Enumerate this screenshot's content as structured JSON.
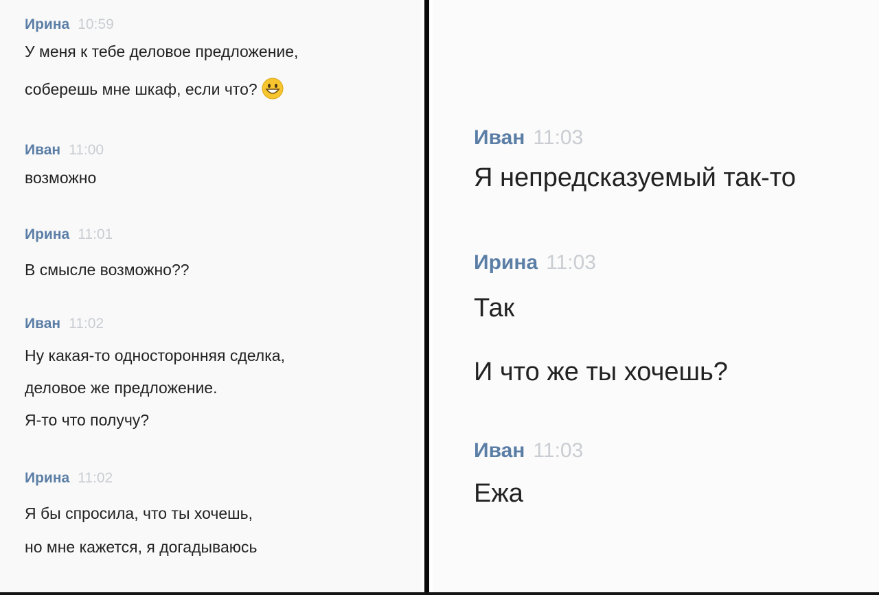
{
  "chat_left": {
    "messages": [
      {
        "author": "Ирина",
        "time": "10:59",
        "lines": [
          "У меня к тебе деловое предложение,",
          "соберешь мне шкаф, если что?"
        ],
        "emoji": "grinning-face-emoji"
      },
      {
        "author": "Иван",
        "time": "11:00",
        "lines": [
          "возможно"
        ]
      },
      {
        "author": "Ирина",
        "time": "11:01",
        "lines": [
          "В смысле возможно??"
        ]
      },
      {
        "author": "Иван",
        "time": "11:02",
        "lines": [
          "Ну какая-то односторонняя сделка,",
          "деловое же предложение.",
          "Я-то что получу?"
        ]
      },
      {
        "author": "Ирина",
        "time": "11:02",
        "lines": [
          "Я бы спросила, что ты хочешь,",
          "но мне кажется, я догадываюсь"
        ]
      }
    ]
  },
  "chat_right": {
    "messages": [
      {
        "author": "Иван",
        "time": "11:03",
        "lines": [
          "Я непредсказуемый так-то"
        ]
      },
      {
        "author": "Ирина",
        "time": "11:03",
        "lines": [
          "Так",
          "И что же ты хочешь?"
        ]
      },
      {
        "author": "Иван",
        "time": "11:03",
        "lines": [
          "Ежа"
        ]
      }
    ]
  }
}
